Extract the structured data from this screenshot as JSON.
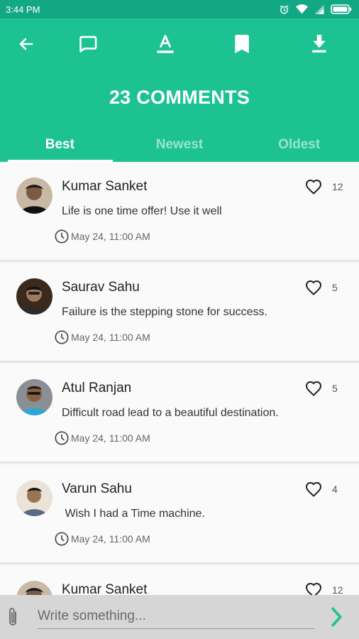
{
  "status_bar": {
    "time": "3:44 PM"
  },
  "header": {
    "title": "23 COMMENTS",
    "toolbar_icons": [
      "back-arrow-icon",
      "comment-icon",
      "text-format-icon",
      "bookmark-icon",
      "download-icon"
    ],
    "tabs": [
      {
        "label": "Best",
        "active": true
      },
      {
        "label": "Newest",
        "active": false
      },
      {
        "label": "Oldest",
        "active": false
      }
    ]
  },
  "comments": [
    {
      "name": "Kumar Sanket",
      "text": "Life is one time offer! Use it well",
      "time": "May 24, 11:00 AM",
      "likes": "12"
    },
    {
      "name": "Saurav Sahu",
      "text": "Failure is the stepping stone for success.",
      "time": "May 24, 11:00 AM",
      "likes": "5"
    },
    {
      "name": "Atul Ranjan",
      "text": "Difficult road lead to a beautiful destination.",
      "time": "May 24, 11:00 AM",
      "likes": "5"
    },
    {
      "name": "Varun Sahu",
      "text": " Wish I had a Time machine.",
      "time": "May 24, 11:00 AM",
      "likes": "4"
    },
    {
      "name": "Kumar Sanket",
      "text": "",
      "time": "",
      "likes": "12"
    }
  ],
  "composer": {
    "placeholder": "Write something...",
    "value": ""
  },
  "colors": {
    "primary": "#1dc293",
    "status_bar": "#13a884",
    "accent": "#1dc293"
  }
}
